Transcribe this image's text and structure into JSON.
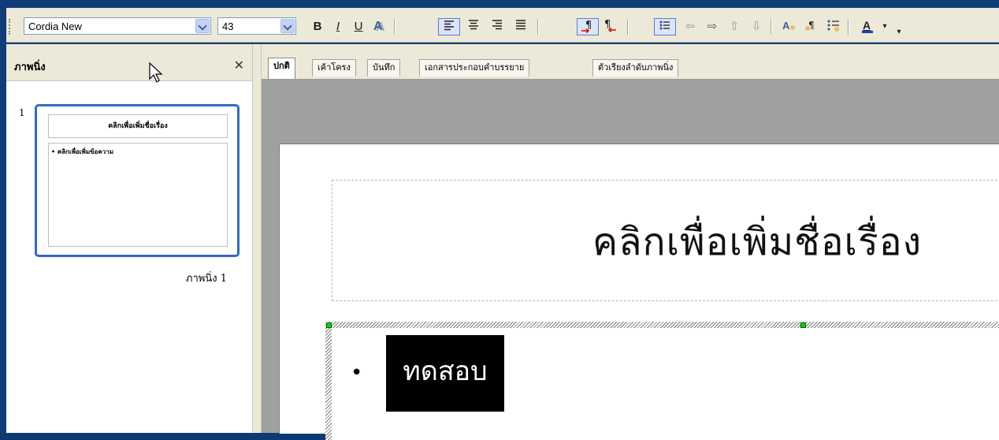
{
  "toolbar": {
    "font_name": "Cordia New",
    "font_size": "43",
    "bold_label": "B",
    "italic_label": "I",
    "underline_label": "U"
  },
  "slides_panel": {
    "title": "ภาพนิ่ง",
    "close_label": "✕",
    "slides": [
      {
        "number": "1",
        "thumb_title": "คลิกเพื่อเพิ่มชื่อเรื่อง",
        "thumb_body": "• คลิกเพื่อเพิ่มข้อความ",
        "label": "ภาพนิ่ง 1"
      }
    ]
  },
  "tabs": [
    {
      "label": "ปกติ"
    },
    {
      "label": "เค้าโครง"
    },
    {
      "label": "บันทึก"
    },
    {
      "label": "เอกสารประกอบคำบรรยาย"
    },
    {
      "label": "ตัวเรียงลำดับภาพนิ่ง"
    }
  ],
  "slide": {
    "title": "คลิกเพื่อเพิ่มชื่อเรื่อง",
    "bullet": "•",
    "body": "ทดสอบ"
  },
  "colors": {
    "frame": "#103c78",
    "toolbar_bg": "#ece9d8",
    "selection_blue": "#316ac5",
    "handle_green": "#00d800"
  }
}
